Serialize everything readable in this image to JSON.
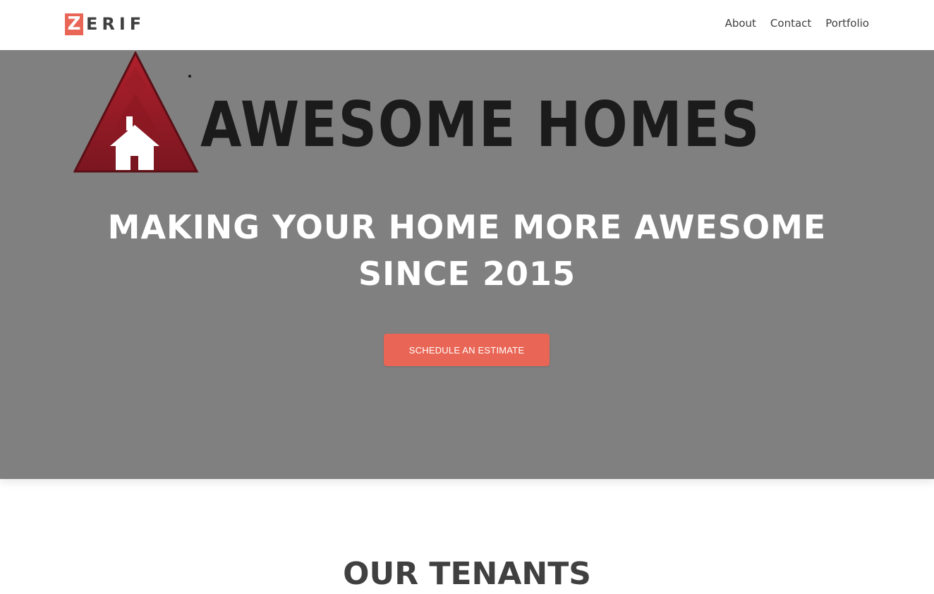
{
  "header": {
    "logo": {
      "first_letter": "Z",
      "rest": "ERIF"
    },
    "nav": [
      "About",
      "Contact",
      "Portfolio"
    ]
  },
  "hero": {
    "brand_name": "AWESOME HOMES",
    "title_line1": "MAKING YOUR HOME MORE AWESOME",
    "title_line2": "SINCE 2015",
    "cta_label": "SCHEDULE AN ESTIMATE"
  },
  "section": {
    "title": "OUR TENANTS"
  },
  "colors": {
    "accent": "#e96656",
    "hero_background": "#808080",
    "text_dark": "#404040",
    "brand_red": "#8b1a22"
  },
  "icons": [
    "house-icon"
  ]
}
